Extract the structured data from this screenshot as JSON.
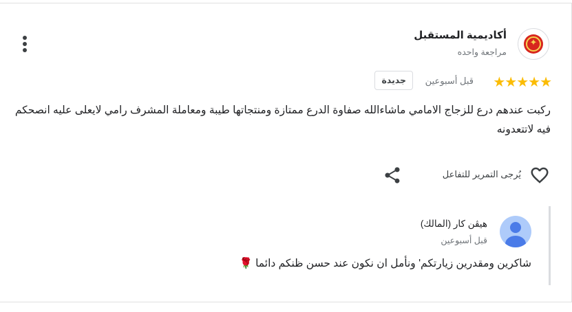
{
  "review": {
    "author_name": "أكاديمية المستقبل",
    "author_subtitle": "مراجعة واحده",
    "rating": 5,
    "stars": "★★★★★",
    "time": "قبل أسبوعين",
    "badge": "جديدة",
    "text": "ركبت عندهم درع للزجاج الامامي ماشاءالله صفاوة الدرع ممتازة ومنتجاتها طيبة ومعاملة المشرف رامي لايعلى عليه انصحكم فيه لاتتعدونه",
    "like_label": "يُرجى التمرير للتفاعل"
  },
  "owner_reply": {
    "name": "هيڤن كار (المالك)",
    "time": "قبل أسبوعين",
    "text": "شاكرين ومقدرين زيارتكم' ونأمل ان نكون عند حسن ظنكم دائما 🌹"
  },
  "colors": {
    "star": "#fbbc04",
    "logo_red": "#d7261e",
    "owner_avatar": "#4a7be8"
  },
  "icons": {
    "more": "more-vert-icon",
    "like": "heart-outline-icon",
    "share": "share-icon"
  }
}
